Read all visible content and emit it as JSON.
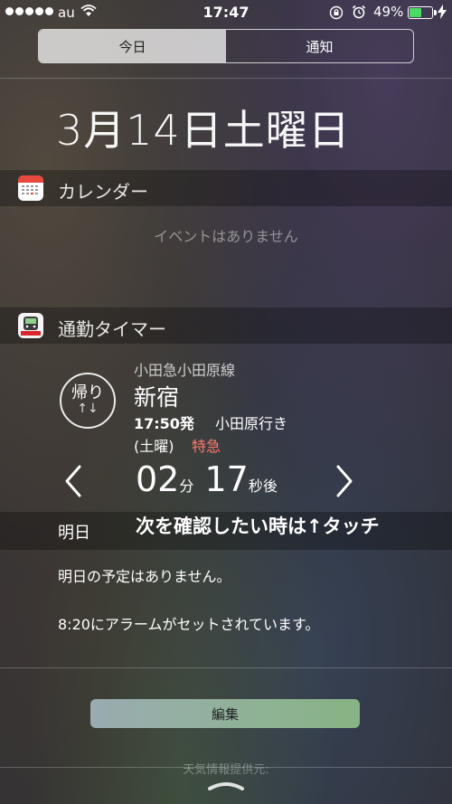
{
  "status_bar": {
    "carrier": "au",
    "time": "17:47",
    "battery": "49%",
    "battery_level": 0.49,
    "icons": [
      "signal-dots",
      "wifi-icon",
      "rotation-lock-icon",
      "alarm-icon",
      "battery-icon",
      "charging-bolt-icon"
    ]
  },
  "tabs": [
    {
      "label": "今日",
      "selected": true
    },
    {
      "label": "通知",
      "selected": false
    }
  ],
  "date": "3月14日土曜日",
  "calendar": {
    "title": "カレンダー",
    "empty": "イベントはありません"
  },
  "timer": {
    "title": "通勤タイマー",
    "direction": "帰り",
    "direction_arrows": "↑↓",
    "line": "小田急小田原線",
    "station": "新宿",
    "departure": "17:50発",
    "bound": "小田原行き",
    "day": "(土曜)",
    "train_type": "特急",
    "minutes": "02",
    "minutes_unit": "分",
    "seconds": "17",
    "seconds_unit": "秒後",
    "hint": "次を確認したい時は↑タッチ"
  },
  "tomorrow": {
    "title": "明日",
    "no_plans": "明日の予定はありません。",
    "alarm": "8:20にアラームがセットされています。"
  },
  "edit_button": "編集",
  "credit": "天気情報提供元:",
  "colors": {
    "selected_tab": "#bfbfbf",
    "express": "#ff7a6e",
    "battery": "#4cd964"
  }
}
